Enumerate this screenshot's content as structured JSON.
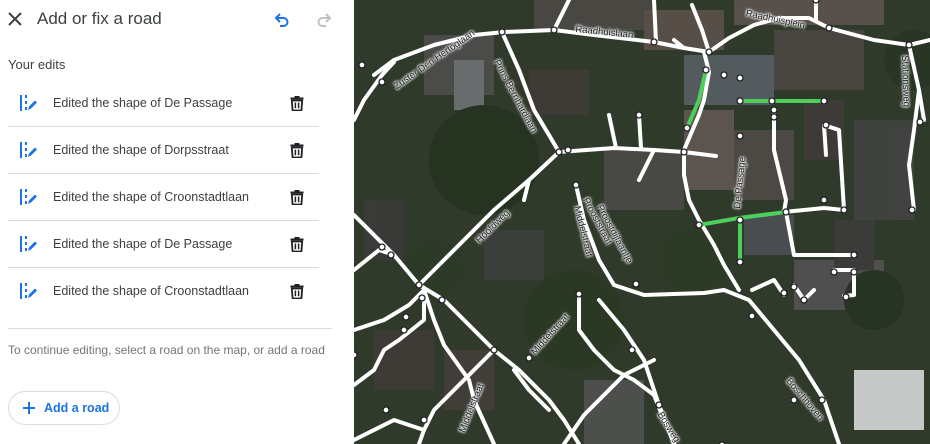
{
  "header": {
    "title": "Add or fix a road",
    "close_icon": "close-icon",
    "undo_icon": "undo-icon",
    "redo_icon": "redo-icon"
  },
  "edits": {
    "section_label": "Your edits",
    "items": [
      {
        "label": "Edited the shape of De Passage",
        "icon": "edit-road-icon"
      },
      {
        "label": "Edited the shape of Dorpsstraat",
        "icon": "edit-road-icon"
      },
      {
        "label": "Edited the shape of Croonstadtlaan",
        "icon": "edit-road-icon"
      },
      {
        "label": "Edited the shape of De Passage",
        "icon": "edit-road-icon"
      },
      {
        "label": "Edited the shape of Croonstadtlaan",
        "icon": "edit-road-icon"
      }
    ]
  },
  "footer": {
    "help_text": "To continue editing, select a road on the map, or add a road",
    "add_road_label": "Add a road"
  },
  "map": {
    "street_labels": {
      "zuster": "Zuster Den Hertoglaan",
      "raadhuislaan": "Raadhuislaan",
      "raadhuisplein": "Raadhuisplein",
      "prins": "Prins Bernhardlaan",
      "stationsweg": "Stationsweg",
      "depassage": "De Passage",
      "hoofdweg": "Hoofdweg",
      "middelstraat1": "Middelstraat",
      "middelstraat2": "Middelstraat",
      "middelstraat3": "Middelstraat",
      "prooststraat": "Prooststraat",
      "proostdijlaantje": "Proostdijlaantje",
      "bosweg": "Bosweg",
      "boschhoven": "Boschhoven"
    }
  },
  "colors": {
    "accent": "#1a73e8",
    "edited_road": "#4ecf5b",
    "road": "#ffffff",
    "text": "#3c4043",
    "muted": "#70757a",
    "divider": "#dadce0"
  }
}
